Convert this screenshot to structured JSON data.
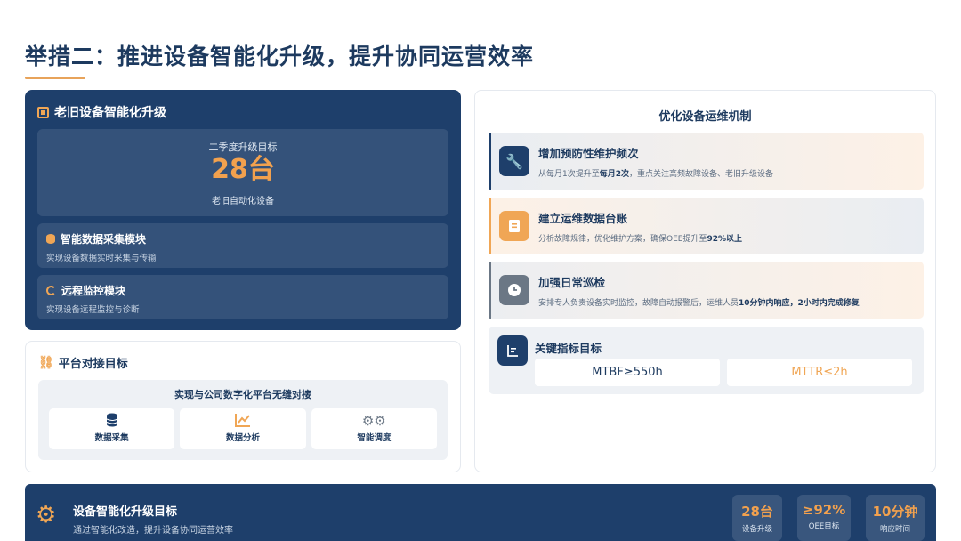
{
  "page": {
    "title": "举措二：推进设备智能化升级，提升协同运营效率"
  },
  "upgrade_card": {
    "heading": "老旧设备智能化升级",
    "target_label": "二季度升级目标",
    "target_value": "28台",
    "target_sub": "老旧自动化设备",
    "modules": [
      {
        "title": "智能数据采集模块",
        "desc": "实现设备数据实时采集与传输",
        "icon": "database-icon"
      },
      {
        "title": "远程监控模块",
        "desc": "实现设备远程监控与诊断",
        "icon": "satellite-icon"
      }
    ]
  },
  "platform_card": {
    "heading": "平台对接目标",
    "subtitle": "实现与公司数字化平台无缝对接",
    "items": [
      {
        "label": "数据采集",
        "icon": "database-icon"
      },
      {
        "label": "数据分析",
        "icon": "line-chart-icon"
      },
      {
        "label": "智能调度",
        "icon": "gears-icon"
      }
    ]
  },
  "ops_card": {
    "heading": "优化设备运维机制",
    "items": [
      {
        "title": "增加预防性维护频次",
        "desc_pre": "从每月1次提升至",
        "desc_bold": "每月2次",
        "desc_post": "，重点关注高频故障设备、老旧升级设备",
        "icon": "wrench-icon"
      },
      {
        "title": "建立运维数据台账",
        "desc_pre": "分析故障规律，优化维护方案，确保OEE提升至",
        "desc_bold": "92%以上",
        "desc_post": "",
        "icon": "ledger-icon"
      },
      {
        "title": "加强日常巡检",
        "desc_pre": "安排专人负责设备实时监控，故障自动报警后，运维人员",
        "desc_bold": "10分钟内响应，2小时内完成修复",
        "desc_post": "",
        "icon": "clock-icon"
      }
    ],
    "kpi": {
      "title": "关键指标目标",
      "mtbf": "MTBF≥550h",
      "mttr": "MTTR≤2h"
    }
  },
  "banner": {
    "title": "设备智能化升级目标",
    "subtitle": "通过智能化改造，提升设备协同运营效率",
    "stats": [
      {
        "value": "28台",
        "label": "设备升级"
      },
      {
        "value": "≥92%",
        "label": "OEE目标"
      },
      {
        "value": "10分钟",
        "label": "响应时间"
      }
    ]
  },
  "colors": {
    "navy": "#1e3f6b",
    "orange": "#f2a14e",
    "gray_icon": "#6b7785"
  }
}
